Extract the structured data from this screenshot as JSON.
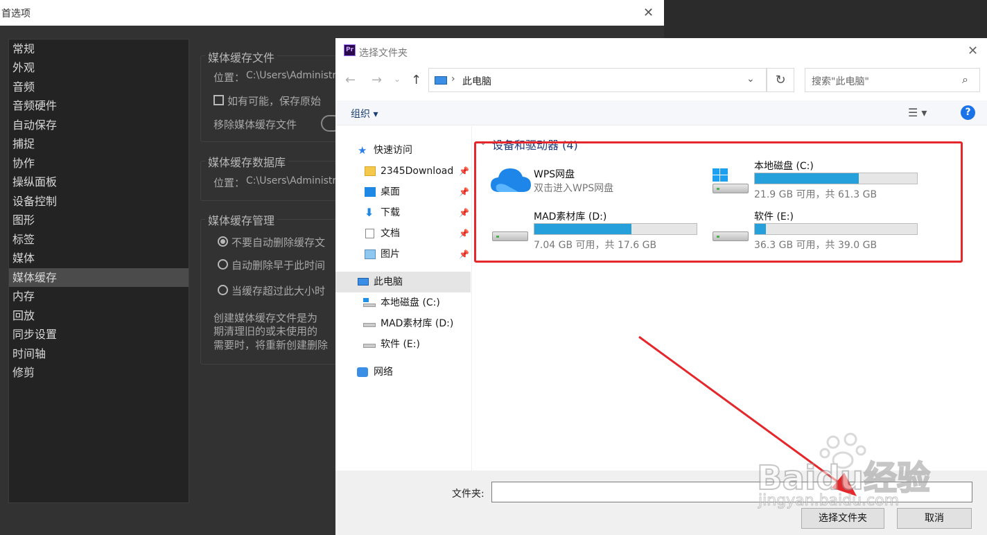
{
  "preferences": {
    "title": "首选项",
    "categories": [
      "常规",
      "外观",
      "音频",
      "音频硬件",
      "自动保存",
      "捕捉",
      "协作",
      "操纵面板",
      "设备控制",
      "图形",
      "标签",
      "媒体",
      "媒体缓存",
      "内存",
      "回放",
      "同步设置",
      "时间轴",
      "修剪"
    ],
    "selected_category": "媒体缓存",
    "cache_files": {
      "title": "媒体缓存文件",
      "location_label": "位置：",
      "location_value": "C:\\Users\\Administrat",
      "checkbox_label": "如有可能，保存原始",
      "remove_label": "移除媒体缓存文件"
    },
    "cache_db": {
      "title": "媒体缓存数据库",
      "location_label": "位置：",
      "location_value": "C:\\Users\\Administrat"
    },
    "cache_mgmt": {
      "title": "媒体缓存管理",
      "options": [
        "不要自动删除缓存文",
        "自动删除早于此时间",
        "当缓存超过此大小时"
      ],
      "selected_option": 0,
      "description": [
        "创建媒体缓存文件是为",
        "期清理旧的或未使用的",
        "需要时，将重新创建删除"
      ]
    }
  },
  "dialog": {
    "title": "选择文件夹",
    "app_icon_label": "Pr",
    "address": "此电脑",
    "search_placeholder": "搜索\"此电脑\"",
    "organize_label": "组织 ▾",
    "help_label": "?",
    "nav": [
      {
        "label": "快速访问",
        "icon": "star-icon",
        "pinned": false
      },
      {
        "label": "2345Download",
        "icon": "folder-icon",
        "pinned": true
      },
      {
        "label": "桌面",
        "icon": "desktop-icon",
        "pinned": true
      },
      {
        "label": "下载",
        "icon": "download-icon",
        "pinned": true
      },
      {
        "label": "文档",
        "icon": "document-icon",
        "pinned": true
      },
      {
        "label": "图片",
        "icon": "picture-icon",
        "pinned": true
      },
      {
        "label": "此电脑",
        "icon": "computer-icon",
        "pinned": false
      },
      {
        "label": "本地磁盘 (C:)",
        "icon": "windows-drive-icon",
        "pinned": false
      },
      {
        "label": "MAD素材库 (D:)",
        "icon": "drive-icon",
        "pinned": false
      },
      {
        "label": "软件 (E:)",
        "icon": "drive-icon",
        "pinned": false
      },
      {
        "label": "网络",
        "icon": "network-icon",
        "pinned": false
      }
    ],
    "selected_nav": "此电脑",
    "group_header": "设备和驱动器 (4)",
    "drives": [
      {
        "name": "WPS网盘",
        "subtitle": "双击进入WPS网盘",
        "icon": "cloud-icon"
      },
      {
        "name": "本地磁盘 (C:)",
        "free_info": "21.9 GB 可用，共 61.3 GB",
        "used_fraction": 0.643,
        "icon": "windows-drive-icon"
      },
      {
        "name": "MAD素材库 (D:)",
        "free_info": "7.04 GB 可用，共 17.6 GB",
        "used_fraction": 0.6,
        "icon": "drive-icon"
      },
      {
        "name": "软件 (E:)",
        "free_info": "36.3 GB 可用，共 39.0 GB",
        "used_fraction": 0.069,
        "icon": "drive-icon"
      }
    ],
    "folder_label": "文件夹:",
    "folder_value": "",
    "select_button": "选择文件夹",
    "cancel_button": "取消"
  },
  "watermark": {
    "brand": "Baidu经验",
    "url": "jingyan.baidu.com"
  },
  "colors": {
    "highlight_red": "#e5262a",
    "bar_blue": "#26a0da"
  }
}
